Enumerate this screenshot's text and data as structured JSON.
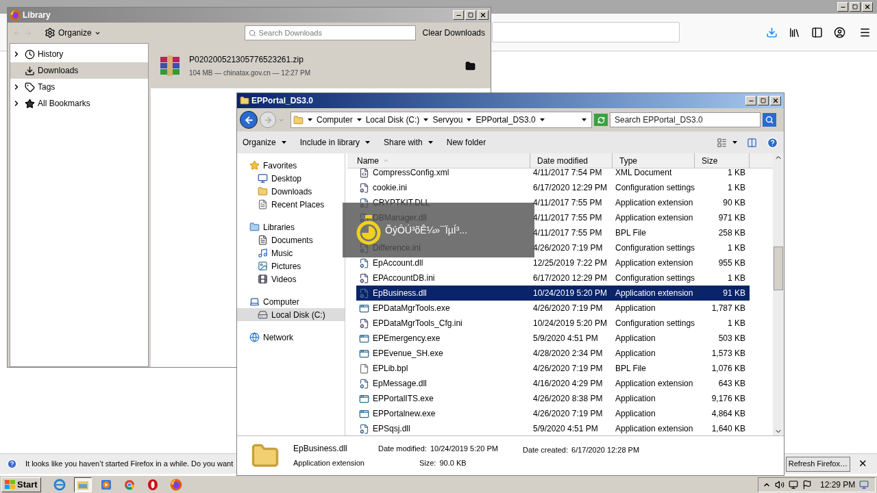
{
  "browser": {
    "notification": {
      "text": "It looks like you haven’t started Firefox in a while. Do you want",
      "button": "Refresh Firefox…",
      "close": "✕"
    }
  },
  "library": {
    "title": "Library",
    "organize": "Organize",
    "search_placeholder": "Search Downloads",
    "clear": "Clear Downloads",
    "sidebar": [
      {
        "label": "History",
        "expandable": true,
        "selected": false,
        "kind": "history"
      },
      {
        "label": "Downloads",
        "expandable": false,
        "selected": true,
        "kind": "downloads"
      },
      {
        "label": "Tags",
        "expandable": true,
        "selected": false,
        "kind": "tags"
      },
      {
        "label": "All Bookmarks",
        "expandable": true,
        "selected": false,
        "kind": "bookmarks"
      }
    ],
    "downloads": [
      {
        "name": "P020200521305776523261.zip",
        "meta": "104 MB — chinatax.gov.cn — 12:27 PM",
        "selected": true
      }
    ]
  },
  "explorer": {
    "title": "EPPortal_DS3.0",
    "breadcrumb": [
      "Computer",
      "Local Disk (C:)",
      "Servyou",
      "EPPortal_DS3.0"
    ],
    "search_placeholder": "Search EPPortal_DS3.0",
    "commands": [
      {
        "label": "Organize",
        "dropdown": true
      },
      {
        "label": "Include in library",
        "dropdown": true
      },
      {
        "label": "Share with",
        "dropdown": true
      },
      {
        "label": "New folder",
        "dropdown": false
      }
    ],
    "nav": [
      {
        "label": "Favorites",
        "kind": "star",
        "selected": false,
        "children": [
          {
            "label": "Desktop",
            "kind": "desktop",
            "selected": false
          },
          {
            "label": "Downloads",
            "kind": "downloads",
            "selected": false
          },
          {
            "label": "Recent Places",
            "kind": "recent",
            "selected": false
          }
        ]
      },
      {
        "label": "Libraries",
        "kind": "libraries",
        "selected": false,
        "children": [
          {
            "label": "Documents",
            "kind": "documents",
            "selected": false
          },
          {
            "label": "Music",
            "kind": "music",
            "selected": false
          },
          {
            "label": "Pictures",
            "kind": "pictures",
            "selected": false
          },
          {
            "label": "Videos",
            "kind": "videos",
            "selected": false
          }
        ]
      },
      {
        "label": "Computer",
        "kind": "computer",
        "selected": false,
        "children": [
          {
            "label": "Local Disk (C:)",
            "kind": "disk",
            "selected": true
          }
        ]
      },
      {
        "label": "Network",
        "kind": "network",
        "selected": false
      }
    ],
    "columns": [
      "Name",
      "Date modified",
      "Type",
      "Size"
    ],
    "rows": [
      {
        "name": "CompressConfig.xml",
        "date": "4/11/2017 7:54 PM",
        "type": "XML Document",
        "size": "1 KB",
        "kind": "xml",
        "selected": false
      },
      {
        "name": "cookie.ini",
        "date": "6/17/2020 12:29 PM",
        "type": "Configuration settings",
        "size": "1 KB",
        "kind": "ini",
        "selected": false
      },
      {
        "name": "CRYPTKIT.DLL",
        "date": "4/11/2017 7:55 PM",
        "type": "Application extension",
        "size": "90 KB",
        "kind": "dll",
        "selected": false
      },
      {
        "name": "DBManager.dll",
        "date": "4/11/2017 7:55 PM",
        "type": "Application extension",
        "size": "971 KB",
        "kind": "dll",
        "selected": false
      },
      {
        "date": "4/11/2017 7:55 PM",
        "type": "BPL File",
        "size": "258 KB",
        "selected": false
      },
      {
        "name": "Difference.ini",
        "date": "4/26/2020 7:19 PM",
        "type": "Configuration settings",
        "size": "1 KB",
        "kind": "ini",
        "selected": false
      },
      {
        "name": "EpAccount.dll",
        "date": "12/25/2019 7:22 PM",
        "type": "Application extension",
        "size": "955 KB",
        "kind": "dll",
        "selected": false
      },
      {
        "name": "EPAccountDB.ini",
        "date": "6/17/2020 12:29 PM",
        "type": "Configuration settings",
        "size": "1 KB",
        "kind": "ini",
        "selected": false
      },
      {
        "name": "EpBusiness.dll",
        "date": "10/24/2019 5:20 PM",
        "type": "Application extension",
        "size": "91 KB",
        "kind": "dll",
        "selected": true
      },
      {
        "name": "EPDataMgrTools.exe",
        "date": "4/26/2020 7:19 PM",
        "type": "Application",
        "size": "1,787 KB",
        "kind": "exe",
        "selected": false
      },
      {
        "name": "EPDataMgrTools_Cfg.ini",
        "date": "10/24/2019 5:20 PM",
        "type": "Configuration settings",
        "size": "1 KB",
        "kind": "ini",
        "selected": false
      },
      {
        "name": "EPEmergency.exe",
        "date": "5/9/2020 4:51 PM",
        "type": "Application",
        "size": "503 KB",
        "kind": "exe",
        "selected": false
      },
      {
        "name": "EPEvenue_SH.exe",
        "date": "4/28/2020 2:34 PM",
        "type": "Application",
        "size": "1,573 KB",
        "kind": "exe",
        "selected": false
      },
      {
        "name": "EPLib.bpl",
        "date": "4/26/2020 7:19 PM",
        "type": "BPL File",
        "size": "1,076 KB",
        "kind": "bpl",
        "selected": false
      },
      {
        "name": "EpMessage.dll",
        "date": "4/16/2020 4:29 PM",
        "type": "Application extension",
        "size": "643 KB",
        "kind": "dll",
        "selected": false
      },
      {
        "name": "EPPortalITS.exe",
        "date": "4/26/2020 8:38 PM",
        "type": "Application",
        "size": "9,176 KB",
        "kind": "exe",
        "selected": false
      },
      {
        "name": "EPPortalnew.exe",
        "date": "4/26/2020 7:19 PM",
        "type": "Application",
        "size": "4,864 KB",
        "kind": "exe",
        "selected": false
      },
      {
        "name": "EPSqsj.dll",
        "date": "5/9/2020 4:51 PM",
        "type": "Application extension",
        "size": "1,640 KB",
        "kind": "dll",
        "selected": false
      }
    ],
    "details": {
      "name": "EpBusiness.dll",
      "type": "Application extension",
      "modified_label": "Date modified:",
      "modified": "10/24/2019 5:20 PM",
      "created_label": "Date created:",
      "created": "6/17/2020 12:28 PM",
      "size_label": "Size:",
      "size": "90.0 KB"
    }
  },
  "toast": {
    "text": "ÕýÔÚ³õÊ¼»¯ÏµÍ³..."
  },
  "taskbar": {
    "start": "Start",
    "apps": [
      {
        "kind": "ie",
        "selected": false
      },
      {
        "kind": "explorer",
        "selected": true
      },
      {
        "kind": "media",
        "selected": false
      },
      {
        "kind": "chrome",
        "selected": false
      },
      {
        "kind": "opera",
        "selected": false
      },
      {
        "kind": "firefox",
        "selected": false
      }
    ],
    "clock": "12:29 PM"
  }
}
